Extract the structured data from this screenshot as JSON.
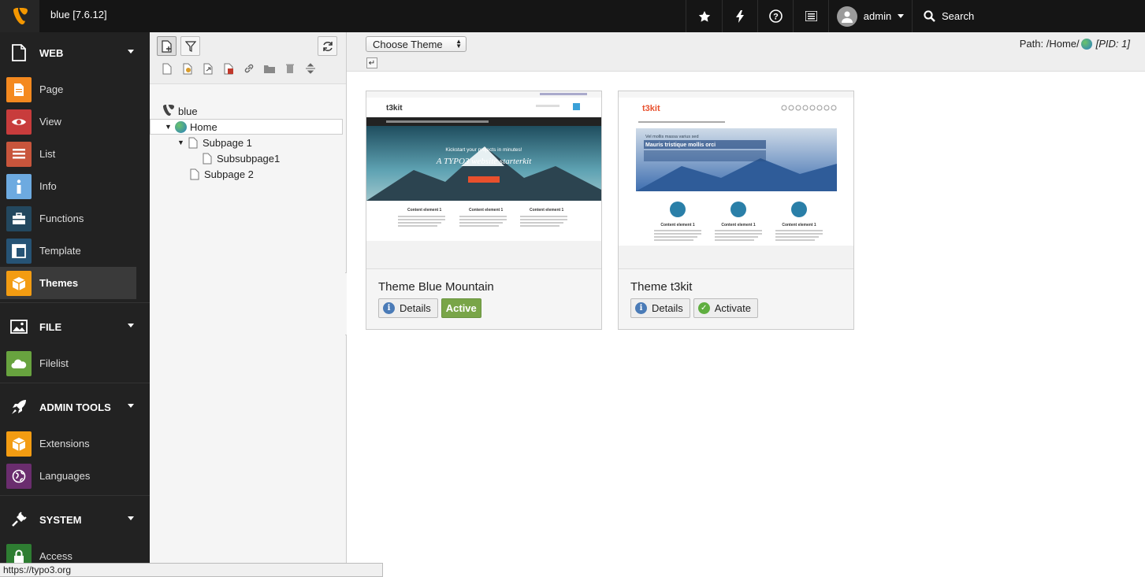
{
  "topbar": {
    "site_title": "blue [7.6.12]",
    "user_name": "admin",
    "search_label": "Search"
  },
  "modules": {
    "web": {
      "label": "WEB",
      "items": [
        {
          "label": "Page",
          "color": "#f4891f"
        },
        {
          "label": "View",
          "color": "#c83c3c"
        },
        {
          "label": "List",
          "color": "#c8553c"
        },
        {
          "label": "Info",
          "color": "#6daae0"
        },
        {
          "label": "Functions",
          "color": "#23485f"
        },
        {
          "label": "Template",
          "color": "#265375"
        },
        {
          "label": "Themes",
          "color": "#f39c12"
        }
      ]
    },
    "file": {
      "label": "FILE",
      "items": [
        {
          "label": "Filelist",
          "color": "#68a33f"
        }
      ]
    },
    "admin": {
      "label": "ADMIN TOOLS",
      "items": [
        {
          "label": "Extensions",
          "color": "#f39c12"
        },
        {
          "label": "Languages",
          "color": "#6a2d6e"
        }
      ]
    },
    "system": {
      "label": "SYSTEM",
      "items": [
        {
          "label": "Access",
          "color": "#2e7d32"
        }
      ]
    }
  },
  "tree": {
    "root": "blue",
    "nodes": [
      "Home",
      "Subpage 1",
      "Subsubpage1",
      "Subpage 2"
    ]
  },
  "docheader": {
    "select_value": "Choose Theme",
    "path_label": "Path: /Home/",
    "pid_label": "[PID: 1]"
  },
  "themes": [
    {
      "name": "Theme Blue Mountain",
      "details_label": "Details",
      "status_label": "Active"
    },
    {
      "name": "Theme t3kit",
      "details_label": "Details",
      "status_label": "Activate"
    }
  ],
  "thumbs": {
    "t3kit_logo": "t3kit",
    "hero_small": "Kickstart your projects in minutes!",
    "hero_big": "A TYPO3 website starterkit",
    "content_element": "Content element 1",
    "hero2_small": "Vel mollis massa varius sed",
    "hero2_big": "Mauris tristique mollis orci"
  },
  "statusbar": {
    "url": "https://typo3.org"
  }
}
